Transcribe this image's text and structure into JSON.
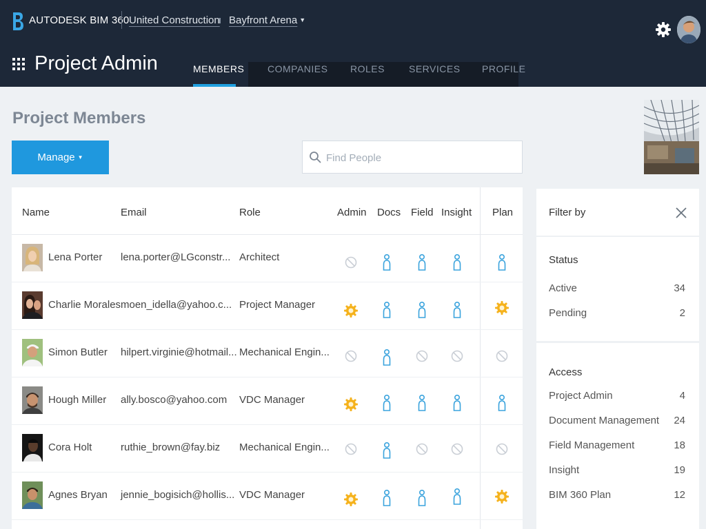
{
  "header": {
    "brand": "AUTODESK BIM 360",
    "account": "United Construction",
    "project": "Bayfront Arena",
    "app_title": "Project Admin"
  },
  "tabs": [
    {
      "label": "MEMBERS",
      "active": true
    },
    {
      "label": "COMPANIES",
      "active": false
    },
    {
      "label": "ROLES",
      "active": false
    },
    {
      "label": "SERVICES",
      "active": false
    },
    {
      "label": "PROFILE",
      "active": false
    }
  ],
  "page": {
    "title": "Project Members",
    "manage_label": "Manage",
    "search_placeholder": "Find People"
  },
  "table": {
    "columns": [
      "Name",
      "Email",
      "Role",
      "Admin",
      "Docs",
      "Field",
      "Insight",
      "Plan"
    ],
    "rows": [
      {
        "name": "Lena Porter",
        "email": "lena.porter@LGconstr...",
        "role": "Architect",
        "admin": "none",
        "docs": "user",
        "field": "user",
        "insight": "user",
        "plan": "user"
      },
      {
        "name": "Charlie Morales",
        "email": "moen_idella@yahoo.c...",
        "role": "Project Manager",
        "admin": "admin",
        "docs": "user",
        "field": "user",
        "insight": "user",
        "plan": "admin"
      },
      {
        "name": "Simon Butler",
        "email": "hilpert.virginie@hotmail...",
        "role": "Mechanical Engin...",
        "admin": "none",
        "docs": "user",
        "field": "none",
        "insight": "none",
        "plan": "none"
      },
      {
        "name": "Hough Miller",
        "email": "ally.bosco@yahoo.com",
        "role": "VDC Manager",
        "admin": "admin",
        "docs": "user",
        "field": "user",
        "insight": "user",
        "plan": "user"
      },
      {
        "name": "Cora Holt",
        "email": "ruthie_brown@fay.biz",
        "role": "Mechanical Engin...",
        "admin": "none",
        "docs": "user",
        "field": "none",
        "insight": "none",
        "plan": "none"
      },
      {
        "name": "Agnes Bryan",
        "email": "jennie_bogisich@hollis...",
        "role": "VDC Manager",
        "admin": "admin",
        "docs": "user",
        "field": "user",
        "insight": "user",
        "plan": "admin"
      }
    ]
  },
  "filter": {
    "title": "Filter by",
    "status": {
      "title": "Status",
      "items": [
        {
          "label": "Active",
          "count": "34"
        },
        {
          "label": "Pending",
          "count": "2"
        }
      ]
    },
    "access": {
      "title": "Access",
      "items": [
        {
          "label": "Project Admin",
          "count": "4"
        },
        {
          "label": "Document Management",
          "count": "24"
        },
        {
          "label": "Field Management",
          "count": "18"
        },
        {
          "label": "Insight",
          "count": "19"
        },
        {
          "label": "BIM 360 Plan",
          "count": "12"
        }
      ]
    }
  },
  "colors": {
    "header_bg": "#1d2838",
    "accent": "#1f98de",
    "admin_icon": "#f5b21c",
    "user_icon": "#3aa3dd",
    "none_icon": "#c9ced5"
  }
}
